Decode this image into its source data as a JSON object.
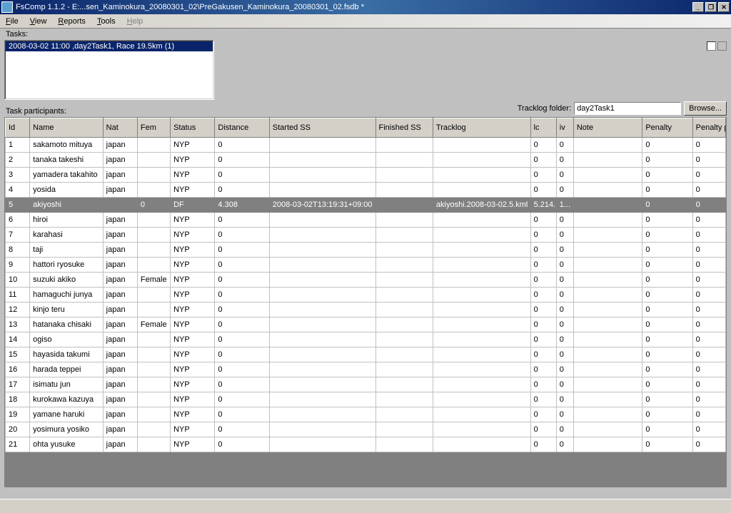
{
  "title": "FsComp 1.1.2 - E:...sen_Kaminokura_20080301_02\\PreGakusen_Kaminokura_20080301_02.fsdb *",
  "menu": {
    "file": "File",
    "view": "View",
    "reports": "Reports",
    "tools": "Tools",
    "help": "Help"
  },
  "labels": {
    "tasks": "Tasks:",
    "participants": "Task participants:",
    "tracklog_folder": "Tracklog folder:",
    "browse": "Browse..."
  },
  "tracklog_input": "day2Task1",
  "task_item": "2008-03-02 11:00 ,day2Task1, Race 19.5km (1)",
  "cols": {
    "id": "Id",
    "name": "Name",
    "nat": "Nat",
    "fem": "Fem",
    "status": "Status",
    "distance": "Distance",
    "started": "Started SS",
    "finished": "Finished SS",
    "tracklog": "Tracklog",
    "lc": "lc",
    "iv": "iv",
    "note": "Note",
    "penalty": "Penalty",
    "pp": "Penalty points"
  },
  "rows": [
    {
      "id": "1",
      "name": "sakamoto mituya",
      "nat": "japan",
      "fem": "",
      "status": "NYP",
      "distance": "0",
      "started": "",
      "finished": "",
      "tracklog": "",
      "lc": "0",
      "iv": "0",
      "note": "",
      "penalty": "0",
      "pp": "0"
    },
    {
      "id": "2",
      "name": "tanaka takeshi",
      "nat": "japan",
      "fem": "",
      "status": "NYP",
      "distance": "0",
      "started": "",
      "finished": "",
      "tracklog": "",
      "lc": "0",
      "iv": "0",
      "note": "",
      "penalty": "0",
      "pp": "0"
    },
    {
      "id": "3",
      "name": "yamadera takahito",
      "nat": "japan",
      "fem": "",
      "status": "NYP",
      "distance": "0",
      "started": "",
      "finished": "",
      "tracklog": "",
      "lc": "0",
      "iv": "0",
      "note": "",
      "penalty": "0",
      "pp": "0"
    },
    {
      "id": "4",
      "name": "yosida",
      "nat": "japan",
      "fem": "",
      "status": "NYP",
      "distance": "0",
      "started": "",
      "finished": "",
      "tracklog": "",
      "lc": "0",
      "iv": "0",
      "note": "",
      "penalty": "0",
      "pp": "0"
    },
    {
      "id": "5",
      "name": "akiyoshi",
      "nat": "",
      "fem": "0",
      "status": "DF",
      "distance": "4.308",
      "started": "2008-03-02T13:19:31+09:00",
      "finished": "",
      "tracklog": "akiyoshi.2008-03-02.5.kml",
      "lc": "5.214...",
      "iv": "1...",
      "note": "",
      "penalty": "0",
      "pp": "0",
      "selected": true
    },
    {
      "id": "6",
      "name": "hiroi",
      "nat": "japan",
      "fem": "",
      "status": "NYP",
      "distance": "0",
      "started": "",
      "finished": "",
      "tracklog": "",
      "lc": "0",
      "iv": "0",
      "note": "",
      "penalty": "0",
      "pp": "0"
    },
    {
      "id": "7",
      "name": "karahasi",
      "nat": "japan",
      "fem": "",
      "status": "NYP",
      "distance": "0",
      "started": "",
      "finished": "",
      "tracklog": "",
      "lc": "0",
      "iv": "0",
      "note": "",
      "penalty": "0",
      "pp": "0"
    },
    {
      "id": "8",
      "name": "taji",
      "nat": "japan",
      "fem": "",
      "status": "NYP",
      "distance": "0",
      "started": "",
      "finished": "",
      "tracklog": "",
      "lc": "0",
      "iv": "0",
      "note": "",
      "penalty": "0",
      "pp": "0"
    },
    {
      "id": "9",
      "name": "hattori ryosuke",
      "nat": "japan",
      "fem": "",
      "status": "NYP",
      "distance": "0",
      "started": "",
      "finished": "",
      "tracklog": "",
      "lc": "0",
      "iv": "0",
      "note": "",
      "penalty": "0",
      "pp": "0"
    },
    {
      "id": "10",
      "name": "suzuki akiko",
      "nat": "japan",
      "fem": "Female",
      "status": "NYP",
      "distance": "0",
      "started": "",
      "finished": "",
      "tracklog": "",
      "lc": "0",
      "iv": "0",
      "note": "",
      "penalty": "0",
      "pp": "0"
    },
    {
      "id": "11",
      "name": "hamaguchi junya",
      "nat": "japan",
      "fem": "",
      "status": "NYP",
      "distance": "0",
      "started": "",
      "finished": "",
      "tracklog": "",
      "lc": "0",
      "iv": "0",
      "note": "",
      "penalty": "0",
      "pp": "0"
    },
    {
      "id": "12",
      "name": "kinjo teru",
      "nat": "japan",
      "fem": "",
      "status": "NYP",
      "distance": "0",
      "started": "",
      "finished": "",
      "tracklog": "",
      "lc": "0",
      "iv": "0",
      "note": "",
      "penalty": "0",
      "pp": "0"
    },
    {
      "id": "13",
      "name": "hatanaka chisaki",
      "nat": "japan",
      "fem": "Female",
      "status": "NYP",
      "distance": "0",
      "started": "",
      "finished": "",
      "tracklog": "",
      "lc": "0",
      "iv": "0",
      "note": "",
      "penalty": "0",
      "pp": "0"
    },
    {
      "id": "14",
      "name": "ogiso",
      "nat": "japan",
      "fem": "",
      "status": "NYP",
      "distance": "0",
      "started": "",
      "finished": "",
      "tracklog": "",
      "lc": "0",
      "iv": "0",
      "note": "",
      "penalty": "0",
      "pp": "0"
    },
    {
      "id": "15",
      "name": "hayasida takumi",
      "nat": "japan",
      "fem": "",
      "status": "NYP",
      "distance": "0",
      "started": "",
      "finished": "",
      "tracklog": "",
      "lc": "0",
      "iv": "0",
      "note": "",
      "penalty": "0",
      "pp": "0"
    },
    {
      "id": "16",
      "name": "harada teppei",
      "nat": "japan",
      "fem": "",
      "status": "NYP",
      "distance": "0",
      "started": "",
      "finished": "",
      "tracklog": "",
      "lc": "0",
      "iv": "0",
      "note": "",
      "penalty": "0",
      "pp": "0"
    },
    {
      "id": "17",
      "name": "isimatu jun",
      "nat": "japan",
      "fem": "",
      "status": "NYP",
      "distance": "0",
      "started": "",
      "finished": "",
      "tracklog": "",
      "lc": "0",
      "iv": "0",
      "note": "",
      "penalty": "0",
      "pp": "0"
    },
    {
      "id": "18",
      "name": "kurokawa kazuya",
      "nat": "japan",
      "fem": "",
      "status": "NYP",
      "distance": "0",
      "started": "",
      "finished": "",
      "tracklog": "",
      "lc": "0",
      "iv": "0",
      "note": "",
      "penalty": "0",
      "pp": "0"
    },
    {
      "id": "19",
      "name": "yamane haruki",
      "nat": "japan",
      "fem": "",
      "status": "NYP",
      "distance": "0",
      "started": "",
      "finished": "",
      "tracklog": "",
      "lc": "0",
      "iv": "0",
      "note": "",
      "penalty": "0",
      "pp": "0"
    },
    {
      "id": "20",
      "name": "yosimura yosiko",
      "nat": "japan",
      "fem": "",
      "status": "NYP",
      "distance": "0",
      "started": "",
      "finished": "",
      "tracklog": "",
      "lc": "0",
      "iv": "0",
      "note": "",
      "penalty": "0",
      "pp": "0"
    },
    {
      "id": "21",
      "name": "ohta yusuke",
      "nat": "japan",
      "fem": "",
      "status": "NYP",
      "distance": "0",
      "started": "",
      "finished": "",
      "tracklog": "",
      "lc": "0",
      "iv": "0",
      "note": "",
      "penalty": "0",
      "pp": "0"
    }
  ]
}
